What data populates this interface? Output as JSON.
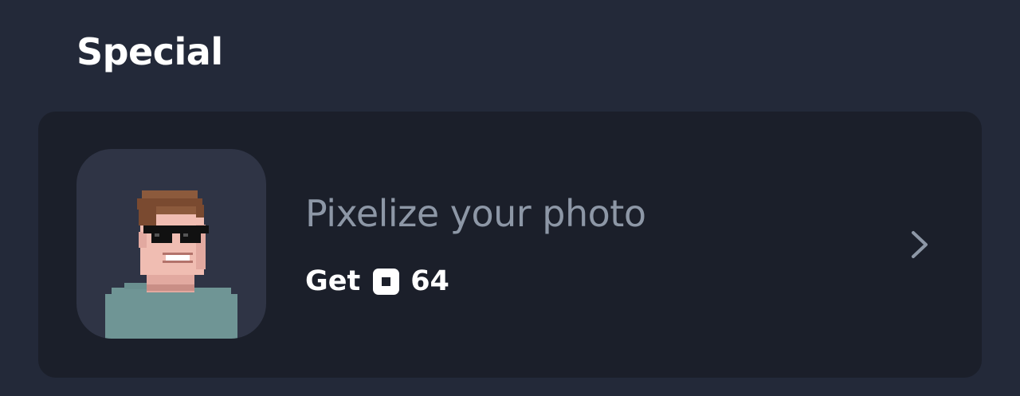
{
  "section": {
    "title": "Special"
  },
  "card": {
    "title": "Pixelize your photo",
    "get_label": "Get",
    "price": "64",
    "icons": {
      "thumbnail": "pixel-avatar-image",
      "coin": "coin-icon",
      "chevron": "chevron-right-icon"
    }
  }
}
